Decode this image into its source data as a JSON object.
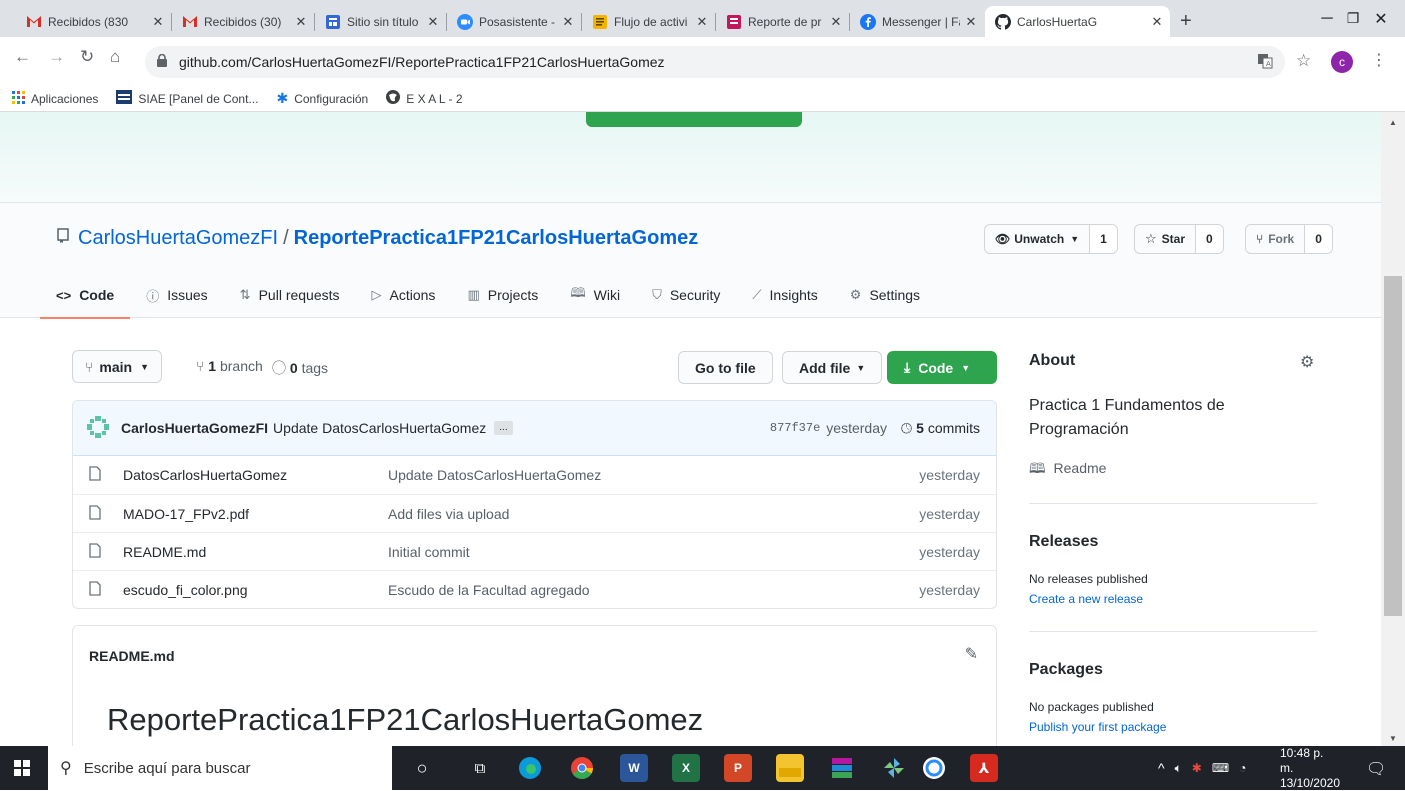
{
  "browser": {
    "tabs": [
      {
        "title": "Recibidos (830",
        "icon": "gmail-icon"
      },
      {
        "title": "Recibidos (30)",
        "icon": "gmail-icon"
      },
      {
        "title": "Sitio sin título",
        "icon": "google-sites-icon"
      },
      {
        "title": "Posasistente -",
        "icon": "zoom-icon"
      },
      {
        "title": "Flujo de activi",
        "icon": "docs-icon"
      },
      {
        "title": "Reporte de pr",
        "icon": "forms-icon"
      },
      {
        "title": "Messenger | Fa",
        "icon": "facebook-icon"
      },
      {
        "title": "CarlosHuertaG",
        "icon": "github-icon",
        "active": true
      }
    ],
    "new_tab": "+",
    "url": "github.com/CarlosHuertaGomezFI/ReportePractica1FP21CarlosHuertaGomez",
    "profile_initial": "c",
    "bookmarks": [
      {
        "label": "Aplicaciones",
        "icon": "apps-grid-icon"
      },
      {
        "label": "SIAE [Panel de Cont...",
        "icon": "siae-icon"
      },
      {
        "label": "Configuración",
        "icon": "gear-icon"
      },
      {
        "label": "E X A L - 2",
        "icon": "globe-icon"
      }
    ]
  },
  "repo": {
    "owner": "CarlosHuertaGomezFI",
    "separator": "/",
    "name": "ReportePractica1FP21CarlosHuertaGomez",
    "watch": {
      "label": "Unwatch",
      "count": "1"
    },
    "star": {
      "label": "Star",
      "count": "0"
    },
    "fork": {
      "label": "Fork",
      "count": "0"
    },
    "tabs": [
      {
        "label": "Code",
        "icon": "code-icon",
        "selected": true
      },
      {
        "label": "Issues",
        "icon": "issue-icon"
      },
      {
        "label": "Pull requests",
        "icon": "pull-request-icon"
      },
      {
        "label": "Actions",
        "icon": "play-icon"
      },
      {
        "label": "Projects",
        "icon": "project-icon"
      },
      {
        "label": "Wiki",
        "icon": "book-icon"
      },
      {
        "label": "Security",
        "icon": "shield-icon"
      },
      {
        "label": "Insights",
        "icon": "graph-icon"
      },
      {
        "label": "Settings",
        "icon": "gear-icon"
      }
    ]
  },
  "code": {
    "branch": "main",
    "branch_count": "1",
    "branch_label": "branch",
    "tag_count": "0",
    "tag_label": "tags",
    "go_to_file": "Go to file",
    "add_file": "Add file",
    "code_button": "Code",
    "commit": {
      "author": "CarlosHuertaGomezFI",
      "message": "Update DatosCarlosHuertaGomez",
      "ellipsis": "...",
      "sha": "877f37e",
      "when": "yesterday",
      "count": "5",
      "count_label": "commits"
    },
    "files": [
      {
        "name": "DatosCarlosHuertaGomez",
        "message": "Update DatosCarlosHuertaGomez",
        "age": "yesterday"
      },
      {
        "name": "MADO-17_FPv2.pdf",
        "message": "Add files via upload",
        "age": "yesterday"
      },
      {
        "name": "README.md",
        "message": "Initial commit",
        "age": "yesterday"
      },
      {
        "name": "escudo_fi_color.png",
        "message": "Escudo de la Facultad agregado",
        "age": "yesterday"
      }
    ],
    "readme_title": "README.md",
    "readme_heading": "ReportePractica1FP21CarlosHuertaGomez"
  },
  "sidebar": {
    "about_title": "About",
    "description_line1": "Practica 1 Fundamentos de",
    "description_line2": "Programación",
    "readme_link": "Readme",
    "releases_title": "Releases",
    "releases_none": "No releases published",
    "releases_link": "Create a new release",
    "packages_title": "Packages",
    "packages_none": "No packages published",
    "packages_link": "Publish your first package"
  },
  "taskbar": {
    "search_placeholder": "Escribe aquí para buscar",
    "time": "10:48 p. m.",
    "date": "13/10/2020"
  },
  "colors": {
    "link": "#0366d6",
    "green": "#2ea44f",
    "tab_underline": "#f9826c"
  }
}
